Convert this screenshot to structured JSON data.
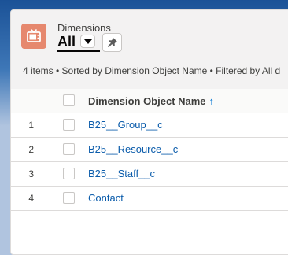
{
  "header": {
    "object_label": "Dimensions",
    "list_view_name": "All",
    "icons": {
      "object": "tv-icon",
      "switcher": "chevron-down-icon",
      "pin": "pin-icon"
    }
  },
  "meta": {
    "summary": "4 items • Sorted by Dimension Object Name • Filtered by All d"
  },
  "table": {
    "columns": {
      "name": "Dimension Object Name",
      "sort_indicator": "↑"
    },
    "rows": [
      {
        "num": "1",
        "name": "B25__Group__c"
      },
      {
        "num": "2",
        "name": "B25__Resource__c"
      },
      {
        "num": "3",
        "name": "B25__Staff__c"
      },
      {
        "num": "4",
        "name": "Contact"
      }
    ]
  },
  "colors": {
    "object_icon": "#e6886e",
    "link": "#0b5cab",
    "sort_arrow": "#0176d3"
  }
}
